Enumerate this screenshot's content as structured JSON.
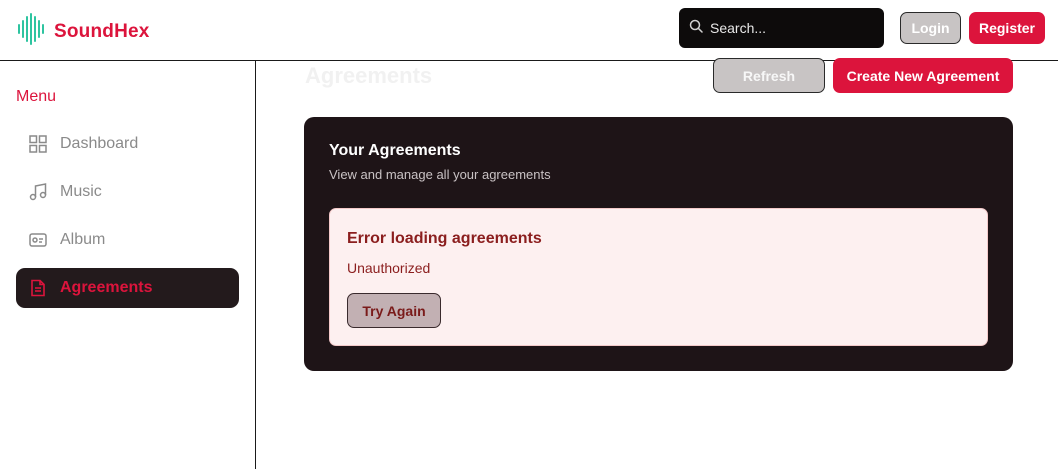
{
  "brand": {
    "name": "SoundHex",
    "icon": "waveform-logo-icon",
    "accent": "#dc143c",
    "logo_color": "#2ec4a0"
  },
  "header": {
    "search": {
      "placeholder": "Search...",
      "icon": "search-icon"
    },
    "login_label": "Login",
    "register_label": "Register"
  },
  "sidebar": {
    "title": "Menu",
    "items": [
      {
        "label": "Dashboard",
        "icon": "grid-icon",
        "active": false
      },
      {
        "label": "Music",
        "icon": "music-note-icon",
        "active": false
      },
      {
        "label": "Album",
        "icon": "album-card-icon",
        "active": false
      },
      {
        "label": "Agreements",
        "icon": "document-icon",
        "active": true
      }
    ]
  },
  "main": {
    "title": "Agreements",
    "refresh_label": "Refresh",
    "create_label": "Create New Agreement",
    "card": {
      "title": "Your Agreements",
      "subtitle": "View and manage all your agreements",
      "error": {
        "title": "Error loading agreements",
        "message": "Unauthorized",
        "retry_label": "Try Again"
      }
    }
  }
}
